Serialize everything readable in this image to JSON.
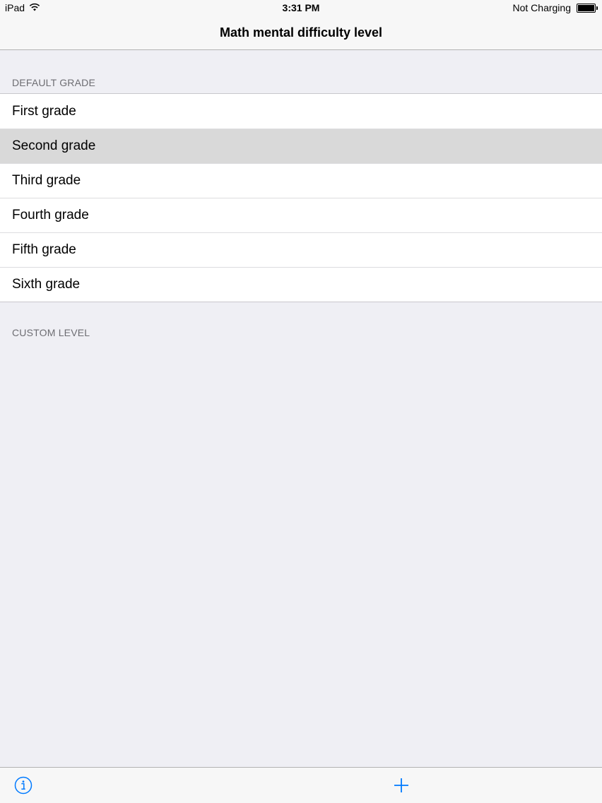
{
  "status_bar": {
    "device": "iPad",
    "time": "3:31 PM",
    "battery_status": "Not Charging",
    "wifi_icon": "wifi-icon",
    "battery_icon": "battery-icon"
  },
  "nav": {
    "title": "Math mental difficulty level"
  },
  "sections": {
    "default_header": "DEFAULT GRADE",
    "custom_header": "CUSTOM LEVEL"
  },
  "grades": [
    {
      "label": "First grade",
      "selected": false
    },
    {
      "label": "Second grade",
      "selected": true
    },
    {
      "label": "Third grade",
      "selected": false
    },
    {
      "label": "Fourth grade",
      "selected": false
    },
    {
      "label": "Fifth grade",
      "selected": false
    },
    {
      "label": "Sixth grade",
      "selected": false
    }
  ],
  "toolbar": {
    "info_icon": "info-icon",
    "add_icon": "plus-icon"
  },
  "colors": {
    "accent": "#007aff",
    "background": "#efeff4",
    "selected_row": "#d9d9d9",
    "section_header_text": "#6d6d72"
  }
}
